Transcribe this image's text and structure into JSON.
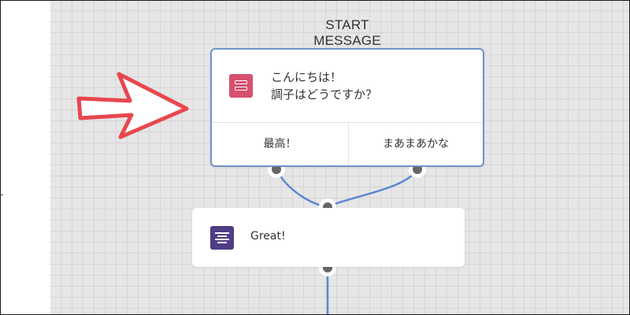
{
  "canvas": {
    "start_label": "START MESSAGE"
  },
  "start_card": {
    "message_line1": "こんにちは！",
    "message_line2": "調子はどうですか？",
    "quick_replies": [
      "最高！",
      "まあまあかな"
    ]
  },
  "next_card": {
    "text": "Great!"
  },
  "colors": {
    "canvas_bg": "#e6e6e6",
    "selected_border": "#6f93c8",
    "connector": "#5b87d0",
    "icon_start": "#d8506f",
    "icon_text": "#4f3d86",
    "annotation_arrow": "#e8474f"
  },
  "icons": {
    "start_icon": "quick-reply-icon",
    "text_icon": "text-message-icon",
    "annotation": "red-arrow"
  }
}
